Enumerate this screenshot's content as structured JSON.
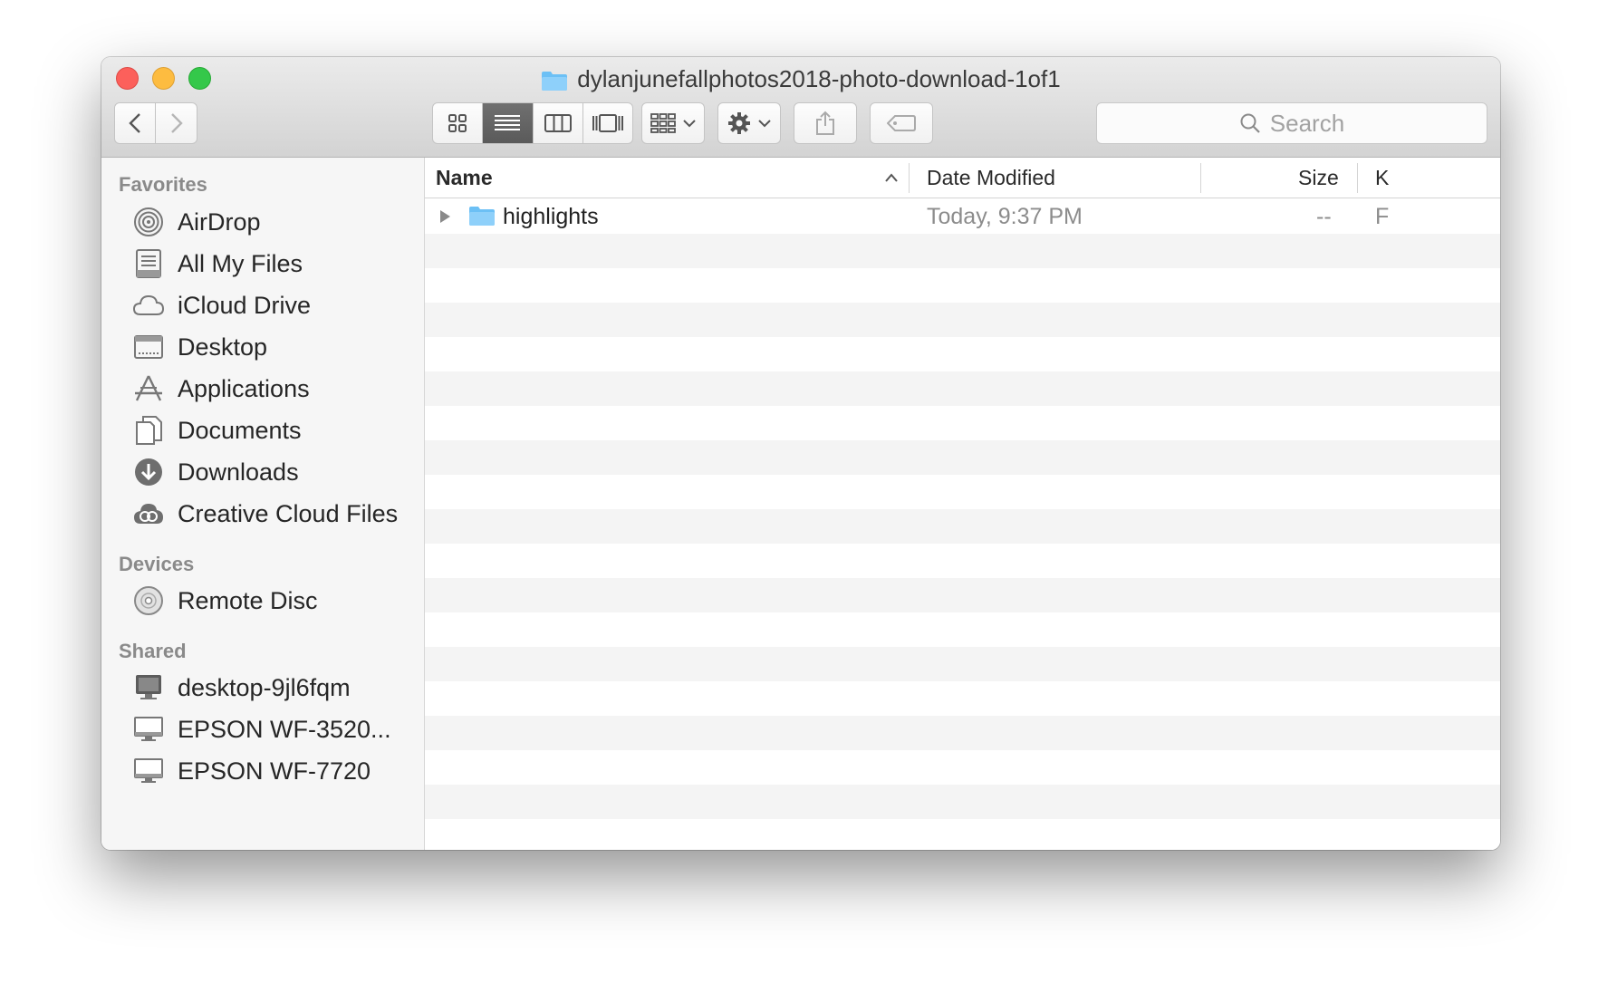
{
  "window": {
    "title": "dylanjunefallphotos2018-photo-download-1of1"
  },
  "toolbar": {
    "back_icon": "chevron-left-icon",
    "forward_icon": "chevron-right-icon",
    "view_modes": [
      "icon-view",
      "list-view",
      "column-view",
      "cover-flow-view"
    ],
    "active_view": "list-view",
    "arrange_icon": "arrange-grid-icon",
    "action_icon": "gear-icon",
    "share_icon": "share-icon",
    "tag_icon": "tag-icon"
  },
  "search": {
    "placeholder": "Search"
  },
  "sidebar": {
    "favorites_title": "Favorites",
    "favorites": [
      {
        "label": "AirDrop",
        "icon": "airdrop-icon"
      },
      {
        "label": "All My Files",
        "icon": "all-my-files-icon"
      },
      {
        "label": "iCloud Drive",
        "icon": "cloud-icon"
      },
      {
        "label": "Desktop",
        "icon": "desktop-icon"
      },
      {
        "label": "Applications",
        "icon": "applications-icon"
      },
      {
        "label": "Documents",
        "icon": "documents-icon"
      },
      {
        "label": "Downloads",
        "icon": "downloads-icon"
      },
      {
        "label": "Creative Cloud Files",
        "icon": "creative-cloud-icon"
      }
    ],
    "devices_title": "Devices",
    "devices": [
      {
        "label": "Remote Disc",
        "icon": "disc-icon"
      }
    ],
    "shared_title": "Shared",
    "shared": [
      {
        "label": "desktop-9jl6fqm",
        "icon": "computer-icon"
      },
      {
        "label": "EPSON WF-3520...",
        "icon": "display-icon"
      },
      {
        "label": "EPSON WF-7720",
        "icon": "display-icon"
      }
    ]
  },
  "columns": {
    "name": "Name",
    "date_modified": "Date Modified",
    "size": "Size",
    "kind": "K",
    "sort_icon": "chevron-up-icon"
  },
  "files": [
    {
      "name": "highlights",
      "date_modified": "Today, 9:37 PM",
      "size": "--",
      "kind": "F",
      "icon": "folder-icon"
    }
  ],
  "colors": {
    "close": "#fc605b",
    "minimize": "#fdbc40",
    "zoom": "#34c84a",
    "folder": "#6cc0f5"
  }
}
